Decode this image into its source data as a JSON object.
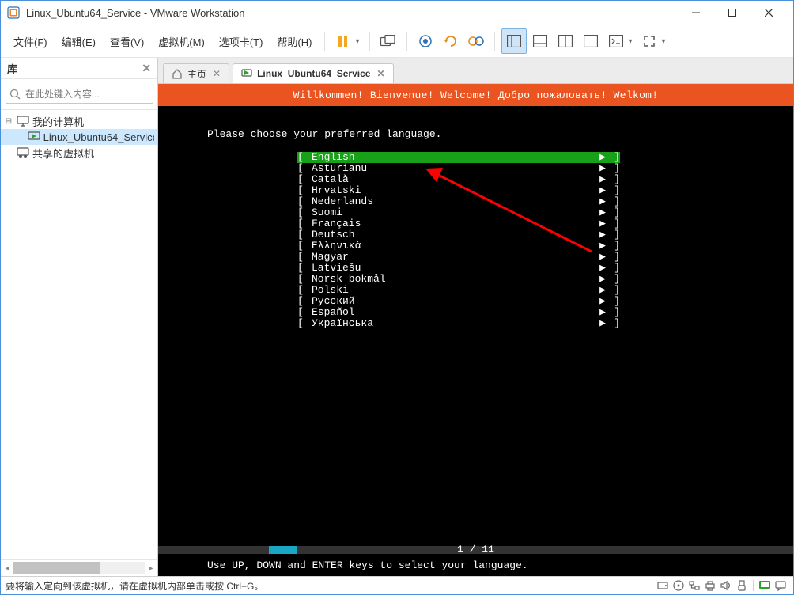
{
  "window": {
    "title": "Linux_Ubuntu64_Service - VMware Workstation"
  },
  "menu": {
    "file": "文件(F)",
    "edit": "编辑(E)",
    "view": "查看(V)",
    "vm": "虚拟机(M)",
    "tabs": "选项卡(T)",
    "help": "帮助(H)"
  },
  "sidebar": {
    "title": "库",
    "search_placeholder": "在此处键入内容...",
    "nodes": {
      "my_computer": "我的计算机",
      "linux_vm": "Linux_Ubuntu64_Service",
      "shared_vm": "共享的虚拟机"
    }
  },
  "tabs": {
    "home": "主页",
    "vm": "Linux_Ubuntu64_Service"
  },
  "installer": {
    "banner": "Willkommen! Bienvenue! Welcome! Добро пожаловать! Welkom!",
    "prompt": "Please choose your preferred language.",
    "languages": [
      "English",
      "Asturianu",
      "Català",
      "Hrvatski",
      "Nederlands",
      "Suomi",
      "Français",
      "Deutsch",
      "Ελληνικά",
      "Magyar",
      "Latviešu",
      "Norsk bokmål",
      "Polski",
      "Русский",
      "Español",
      "Українська"
    ],
    "progress": "1 / 11",
    "hint": "Use UP, DOWN and ENTER keys to select your language."
  },
  "statusbar": {
    "text": "要将输入定向到该虚拟机，请在虚拟机内部单击或按 Ctrl+G。"
  }
}
